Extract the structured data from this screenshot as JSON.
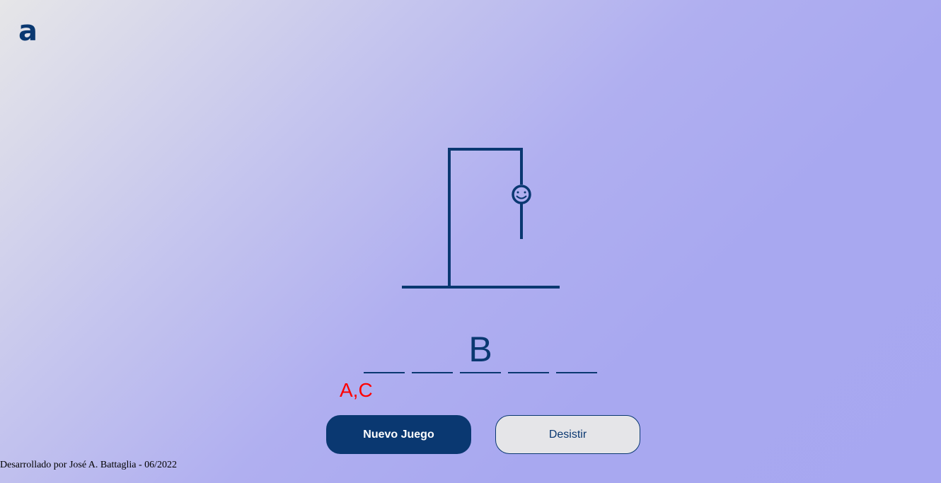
{
  "logo": {
    "text": "a"
  },
  "word": {
    "slots": [
      "",
      "",
      "B",
      "",
      ""
    ]
  },
  "wrong_letters": "A,C",
  "buttons": {
    "new_game": "Nuevo Juego",
    "quit": "Desistir"
  },
  "footer": {
    "credit": "Desarrollado por José A. Battaglia - 06/2022"
  },
  "colors": {
    "primary": "#0a3871",
    "error": "#ff0000"
  },
  "icons": {
    "gallows": "hangman-gallows-icon",
    "head": "smiley-head-icon"
  }
}
